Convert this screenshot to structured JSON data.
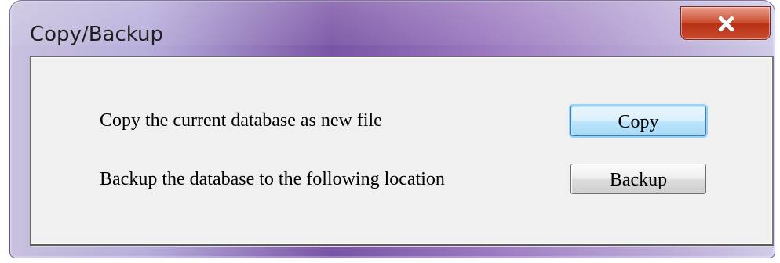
{
  "window": {
    "title": "Copy/Backup",
    "colors": {
      "title_bar_accent": "#7a54a5",
      "close_button": "#c84a2c",
      "panel_background": "#f0f0f0"
    }
  },
  "controls": {
    "close_icon": "close-icon"
  },
  "actions": {
    "copy": {
      "description": "Copy the current database as new file",
      "button_label": "Copy"
    },
    "backup": {
      "description": "Backup the database to the following location",
      "button_label": "Backup"
    }
  }
}
